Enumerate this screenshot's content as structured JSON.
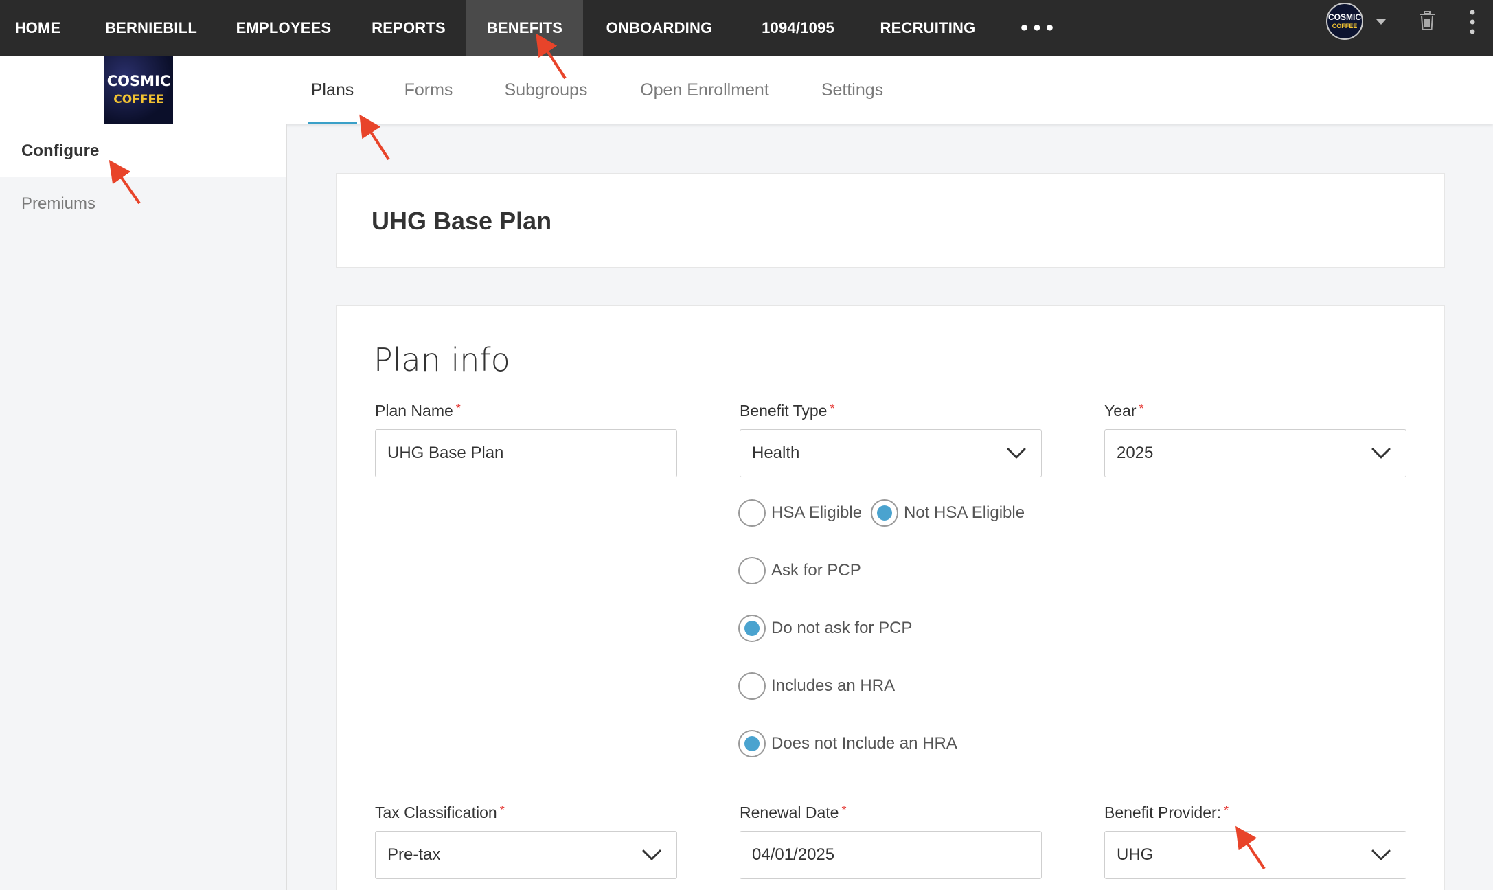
{
  "topnav": {
    "items": [
      {
        "label": "HOME"
      },
      {
        "label": "BERNIEBILL"
      },
      {
        "label": "EMPLOYEES"
      },
      {
        "label": "REPORTS"
      },
      {
        "label": "BENEFITS",
        "active": true
      },
      {
        "label": "ONBOARDING"
      },
      {
        "label": "1094/1095"
      },
      {
        "label": "RECRUITING"
      }
    ],
    "more_label": "•••",
    "avatar_line1": "COSMIC",
    "avatar_line2": "COFFEE",
    "icons": [
      "caret-down-icon",
      "trash-icon",
      "kebab-icon"
    ]
  },
  "logo": {
    "line1": "COSMIC",
    "line2": "COFFEE"
  },
  "subtabs": [
    {
      "label": "Plans",
      "active": true
    },
    {
      "label": "Forms"
    },
    {
      "label": "Subgroups"
    },
    {
      "label": "Open Enrollment"
    },
    {
      "label": "Settings"
    }
  ],
  "sidebar": {
    "items": [
      {
        "label": "Configure",
        "active": true
      },
      {
        "label": "Premiums"
      }
    ]
  },
  "plan_header": {
    "title": "UHG Base Plan"
  },
  "plan_info": {
    "title": "Plan info",
    "plan_name": {
      "label": "Plan Name",
      "value": "UHG Base Plan"
    },
    "benefit_type": {
      "label": "Benefit Type",
      "value": "Health"
    },
    "year": {
      "label": "Year",
      "value": "2025"
    },
    "hsa": {
      "option_yes": "HSA Eligible",
      "option_no": "Not HSA Eligible",
      "selected": "Not HSA Eligible"
    },
    "pcp": {
      "option_yes": "Ask for PCP",
      "option_no": "Do not ask for PCP",
      "selected": "Do not ask for PCP"
    },
    "hra": {
      "option_yes": "Includes an HRA",
      "option_no": "Does not Include an HRA",
      "selected": "Does not Include an HRA"
    },
    "tax_classification": {
      "label": "Tax Classification",
      "value": "Pre-tax"
    },
    "renewal_date": {
      "label": "Renewal Date",
      "value": "04/01/2025"
    },
    "benefit_provider": {
      "label": "Benefit Provider:",
      "value": "UHG"
    },
    "required_mark": "*"
  },
  "colors": {
    "topnav_bg": "#2b2b2b",
    "active_tab_underline": "#3aa0c8",
    "radio_selected": "#4aa3cf",
    "required": "#e53935",
    "annotation_arrow": "#e8442a"
  }
}
